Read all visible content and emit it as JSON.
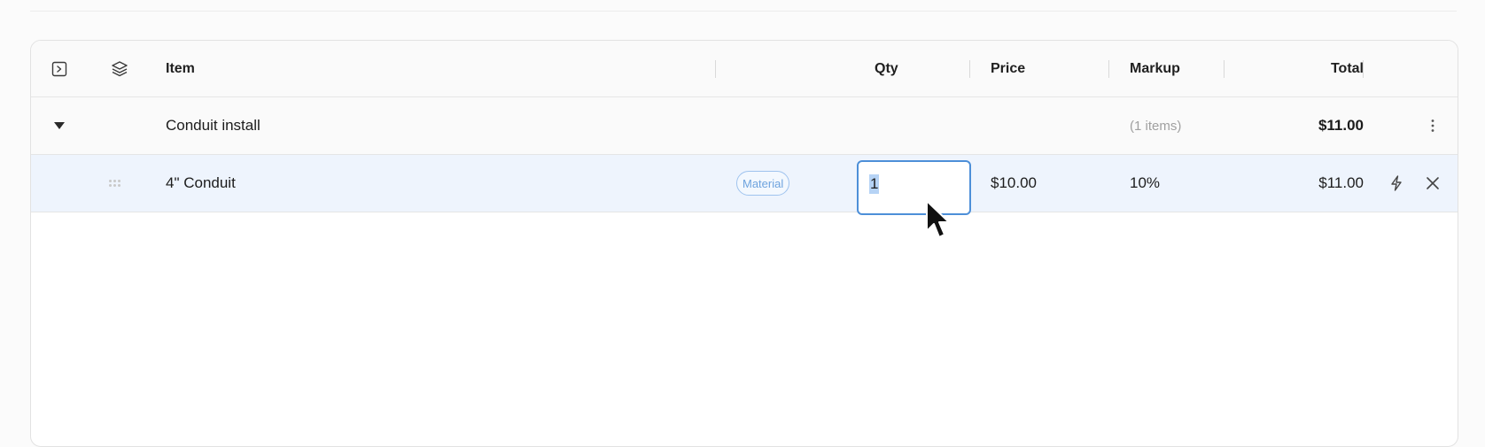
{
  "table": {
    "columns": {
      "item": "Item",
      "qty": "Qty",
      "price": "Price",
      "markup": "Markup",
      "total": "Total"
    },
    "header_icons": [
      "expand-all-icon",
      "layers-icon"
    ],
    "group": {
      "name": "Conduit install",
      "count_label": "(1 items)",
      "total": "$11.00",
      "toggle_icon": "caret-down-icon",
      "menu_icon": "more-vertical-icon"
    },
    "item": {
      "name": "4\" Conduit",
      "badge": "Material",
      "qty": "1",
      "price": "$10.00",
      "markup": "10%",
      "total": "$11.00",
      "action_icons": [
        "bolt-icon",
        "close-icon"
      ]
    }
  },
  "colors": {
    "selected_row_bg": "#eef4fd",
    "focus_border": "#4d8fd8",
    "badge_text": "#6ea3de"
  }
}
